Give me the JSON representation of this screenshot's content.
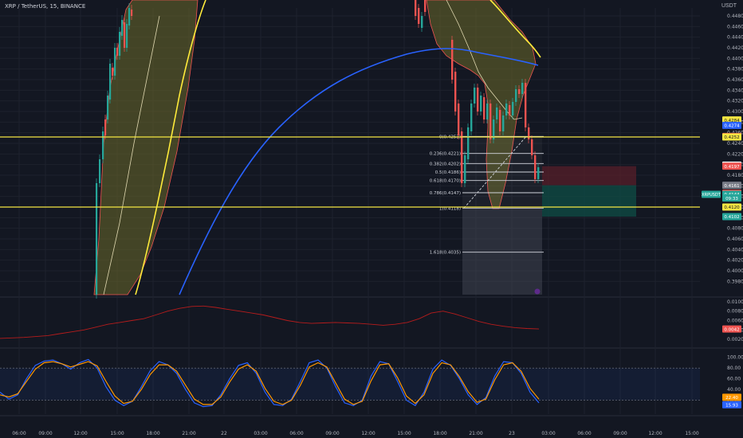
{
  "header": {
    "symbol": "XRP / TetherUS, 15, BINANCE",
    "currency": "USDT"
  },
  "colors": {
    "background": "#131722",
    "grid": "#1e222d",
    "candle_up": "#26a69a",
    "candle_down": "#ef5350",
    "ma_blue": "#2962ff",
    "ma_yellow": "#ffeb3b",
    "band_fill": "#6b6a2a",
    "band_edge": "#ef5350",
    "fib_line": "#d1d4dc",
    "level_yellow": "#f5e642",
    "stop_zone": "#5b1f2a",
    "target_zone": "#0f4a44",
    "oscillator_blue": "#2962ff",
    "oscillator_orange": "#ff9800",
    "volatility_line": "#b71c1c"
  },
  "chart_data": [
    {
      "type": "line",
      "pane": "price",
      "ylim": [
        0.3955,
        0.4495
      ],
      "y_ticks": [
        "0.4480",
        "0.4460",
        "0.4440",
        "0.4420",
        "0.4400",
        "0.4380",
        "0.4360",
        "0.4340",
        "0.4320",
        "0.4300",
        "0.4280",
        "0.4260",
        "0.4240",
        "0.4220",
        "0.4200",
        "0.4180",
        "0.4160",
        "0.4140",
        "0.4120",
        "0.4100",
        "0.4080",
        "0.4060",
        "0.4040",
        "0.4020",
        "0.4000",
        "0.3980"
      ],
      "x_ticks": [
        "06:00",
        "09:00",
        "12:00",
        "15:00",
        "18:00",
        "21:00",
        "22",
        "03:00",
        "06:00",
        "09:00",
        "12:00",
        "15:00",
        "18:00",
        "21:00",
        "23",
        "03:00",
        "06:00",
        "09:00",
        "12:00",
        "15:00"
      ],
      "horizontal_levels": [
        0.4252,
        0.412
      ],
      "fibonacci": [
        {
          "label": "0(0.4253)",
          "value": 0.4253
        },
        {
          "label": "0.236(0.4221)",
          "value": 0.4221
        },
        {
          "label": "0.382(0.4202)",
          "value": 0.4202
        },
        {
          "label": "0.5(0.4186)",
          "value": 0.4186
        },
        {
          "label": "0.618(0.4170)",
          "value": 0.417
        },
        {
          "label": "0.786(0.4147)",
          "value": 0.4147
        },
        {
          "label": "1(0.4118)",
          "value": 0.4118
        },
        {
          "label": "1.618(0.4035)",
          "value": 0.4035
        }
      ],
      "position": {
        "entry": 0.4161,
        "stop": 0.4197,
        "target": 0.4102
      },
      "price_labels": [
        {
          "text": "0.4284",
          "bg": "#f5e642",
          "fg": "#131722"
        },
        {
          "text": "0.4274",
          "bg": "#2962ff",
          "fg": "#ffffff"
        },
        {
          "text": "0.4253",
          "bg": "#ef5350",
          "fg": "#ffffff"
        },
        {
          "text": "0.4252",
          "bg": "#f5e642",
          "fg": "#131722"
        },
        {
          "text": "0.4199",
          "bg": "#ffffff",
          "fg": "#131722"
        },
        {
          "text": "0.4197",
          "bg": "#ef5350",
          "fg": "#ffffff"
        },
        {
          "text": "0.4161",
          "bg": "#787b86",
          "fg": "#ffffff"
        },
        {
          "text": "0.4146",
          "bg": "#ef5350",
          "fg": "#ffffff"
        },
        {
          "text": "0.4144",
          "bg": "#26a69a",
          "fg": "#ffffff"
        },
        {
          "text": "09:33",
          "bg": "#26a69a",
          "fg": "#ffffff"
        },
        {
          "text": "0.4120",
          "bg": "#f5e642",
          "fg": "#131722"
        },
        {
          "text": "0.4102",
          "bg": "#26a69a",
          "fg": "#ffffff"
        }
      ],
      "symbol_tag": "XRPUSDT"
    },
    {
      "type": "line",
      "pane": "volatility",
      "ylim": [
        0.001,
        0.0105
      ],
      "y_ticks": [
        "0.0100",
        "0.0080",
        "0.0060",
        "0.0040",
        "0.0020"
      ],
      "current": "0.0042",
      "series": [
        {
          "values": [
            0.0022,
            0.0023,
            0.0024,
            0.0026,
            0.0028,
            0.0032,
            0.0036,
            0.004,
            0.0046,
            0.0052,
            0.0056,
            0.006,
            0.0064,
            0.0072,
            0.008,
            0.0086,
            0.009,
            0.0091,
            0.0088,
            0.0084,
            0.008,
            0.0076,
            0.0072,
            0.0066,
            0.006,
            0.0056,
            0.0054,
            0.0055,
            0.0056,
            0.0055,
            0.0054,
            0.0052,
            0.005,
            0.0052,
            0.0056,
            0.0064,
            0.0076,
            0.008,
            0.0074,
            0.0066,
            0.0058,
            0.0052,
            0.0048,
            0.0045,
            0.0043,
            0.0042
          ]
        }
      ]
    },
    {
      "type": "line",
      "pane": "oscillator",
      "ylim": [
        0,
        110
      ],
      "y_ticks": [
        "100.00",
        "80.00",
        "60.00",
        "40.00",
        "20.00"
      ],
      "bands": [
        80,
        20
      ],
      "current": [
        "22.40",
        "15.93"
      ],
      "series": [
        {
          "values": [
            35,
            22,
            30,
            60,
            85,
            93,
            95,
            88,
            78,
            90,
            96,
            80,
            45,
            20,
            10,
            18,
            45,
            75,
            92,
            86,
            70,
            40,
            15,
            8,
            10,
            30,
            60,
            85,
            90,
            70,
            35,
            12,
            10,
            22,
            55,
            90,
            95,
            80,
            45,
            15,
            10,
            20,
            65,
            92,
            88,
            55,
            20,
            10,
            35,
            78,
            95,
            85,
            60,
            30,
            12,
            25,
            65,
            92,
            90,
            70,
            35,
            15
          ]
        },
        {
          "values": [
            30,
            26,
            32,
            55,
            78,
            90,
            92,
            88,
            82,
            87,
            92,
            84,
            55,
            28,
            14,
            18,
            40,
            68,
            86,
            86,
            74,
            48,
            22,
            12,
            12,
            26,
            54,
            78,
            86,
            74,
            42,
            18,
            12,
            20,
            48,
            82,
            90,
            82,
            52,
            22,
            12,
            18,
            56,
            86,
            88,
            62,
            28,
            14,
            30,
            70,
            90,
            86,
            64,
            36,
            16,
            22,
            58,
            86,
            90,
            74,
            42,
            22
          ]
        }
      ]
    }
  ]
}
